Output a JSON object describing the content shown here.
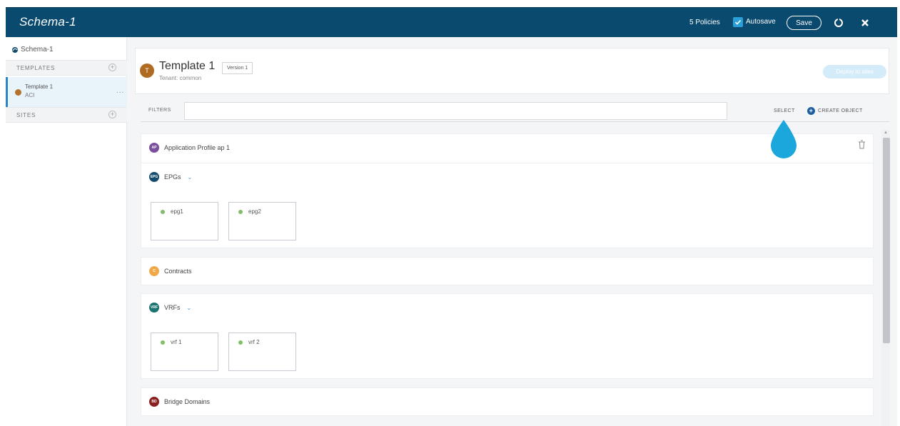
{
  "header": {
    "title": "Schema-1",
    "policies": "5 Policies",
    "autosave_label": "Autosave",
    "autosave_checked": true,
    "save_label": "Save"
  },
  "sidebar": {
    "schema_name": "Schema-1",
    "templates_label": "TEMPLATES",
    "sites_label": "SITES",
    "template": {
      "name": "Template 1",
      "sub": "ACI"
    },
    "more": "..."
  },
  "template_card": {
    "avatar": "T",
    "title": "Template 1",
    "version": "Version 1",
    "tenant": "Tenant: common",
    "deploy_label": "Deploy to sites"
  },
  "filters": {
    "label": "FILTERS",
    "value": "",
    "select_label": "SELECT",
    "create_label": "CREATE OBJECT"
  },
  "sections": {
    "ap": {
      "badge": "AP",
      "title": "Application Profile ap 1",
      "color": "#7a4f9e"
    },
    "epgs": {
      "badge": "EPG",
      "title": "EPGs",
      "color": "#154c6e",
      "items": [
        "epg1",
        "epg2"
      ]
    },
    "contracts": {
      "badge": "C",
      "title": "Contracts",
      "color": "#f0a94a"
    },
    "vrfs": {
      "badge": "VRF",
      "title": "VRFs",
      "color": "#1c7470",
      "items": [
        "vrf 1",
        "vrf 2"
      ]
    },
    "bds": {
      "badge": "BD",
      "title": "Bridge Domains",
      "color": "#8a1f1f"
    }
  },
  "colors": {
    "header_bg": "#0a4a6e",
    "accent": "#2a85c5",
    "drop": "#1ba6dc"
  }
}
